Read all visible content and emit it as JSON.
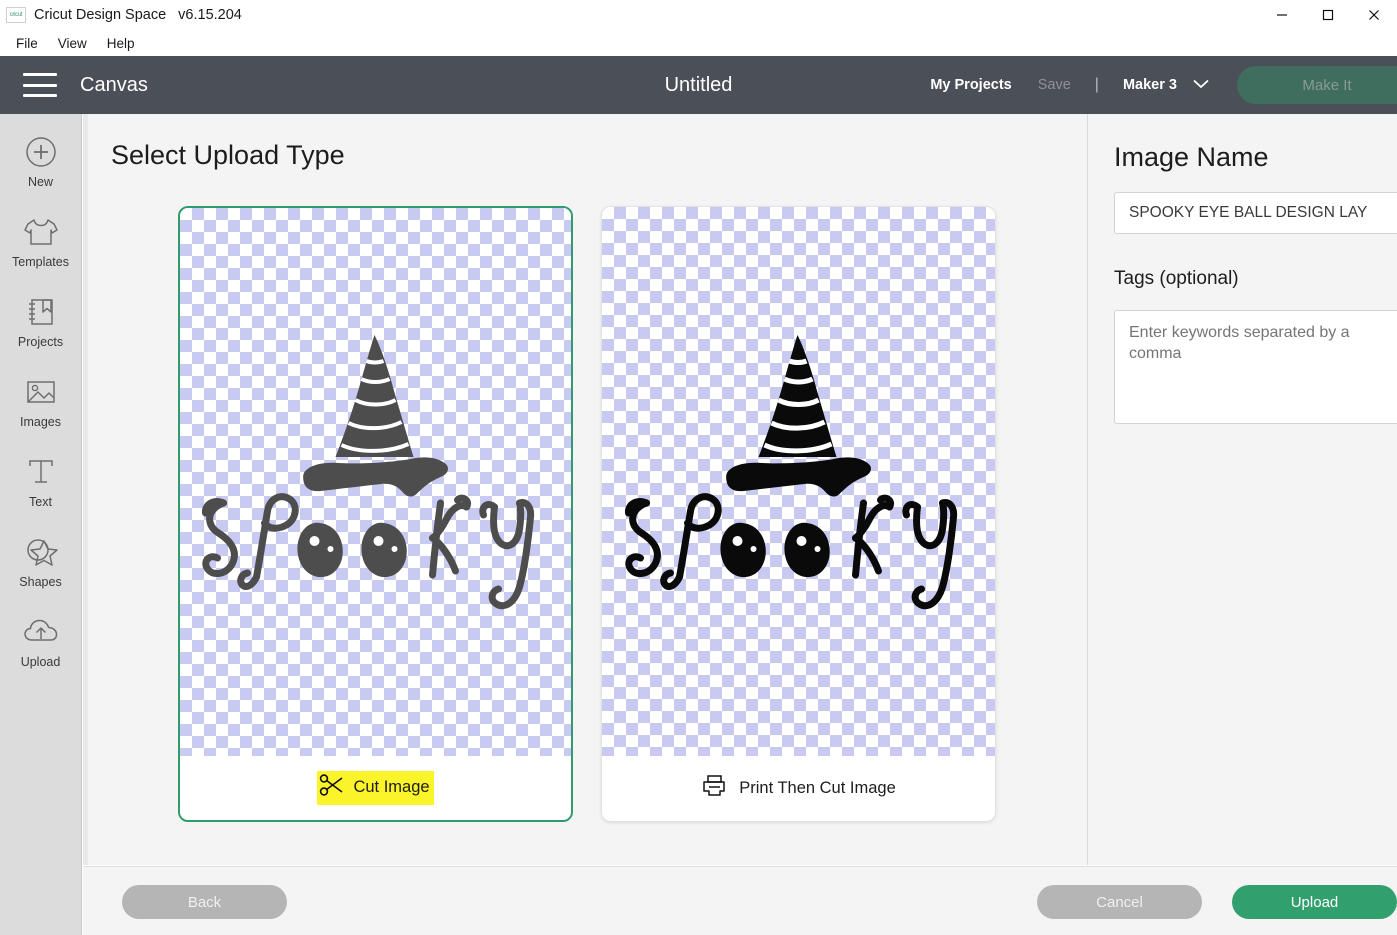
{
  "window": {
    "app_icon_text": "cricut",
    "title": "Cricut Design Space",
    "version": "v6.15.204",
    "controls": [
      {
        "name": "minimize",
        "glyph": "minimize-icon"
      },
      {
        "name": "maximize",
        "glyph": "maximize-icon"
      },
      {
        "name": "close",
        "glyph": "close-icon"
      }
    ]
  },
  "menubar": {
    "items": [
      {
        "label": "File"
      },
      {
        "label": "View"
      },
      {
        "label": "Help"
      }
    ]
  },
  "appheader": {
    "menu_icon": "hamburger-icon",
    "canvas_label": "Canvas",
    "doc_title": "Untitled",
    "my_projects": "My Projects",
    "save": "Save",
    "divider": "|",
    "machine": "Maker 3",
    "machine_chevron": "chevron-down-icon",
    "make_it": "Make It",
    "make_it_color": "#3f6e5f",
    "background_color": "#4b4f57"
  },
  "sidebar": {
    "items": [
      {
        "label": "New",
        "icon": "plus-circle-icon"
      },
      {
        "label": "Templates",
        "icon": "tshirt-icon"
      },
      {
        "label": "Projects",
        "icon": "bookmark-book-icon"
      },
      {
        "label": "Images",
        "icon": "picture-icon"
      },
      {
        "label": "Text",
        "icon": "text-t-icon"
      },
      {
        "label": "Shapes",
        "icon": "shapes-star-icon"
      },
      {
        "label": "Upload",
        "icon": "cloud-upload-icon"
      }
    ]
  },
  "main": {
    "page_title": "Select Upload Type",
    "cards": [
      {
        "id": "cut-image",
        "label": "Cut Image",
        "icon": "scissors-icon",
        "selected": true,
        "highlighted": true,
        "highlight_color": "#fbf42b",
        "border_color": "#2e9c6d",
        "art_color": "#4a4a4a",
        "art_alt": "SPOOKY witch hat lettering preview"
      },
      {
        "id": "print-then-cut-image",
        "label": "Print Then Cut Image",
        "icon": "printer-icon",
        "selected": false,
        "highlighted": false,
        "highlight_color": "",
        "border_color": "#e2e2e2",
        "art_color": "#0a0a0a",
        "art_alt": "SPOOKY witch hat lettering preview"
      }
    ]
  },
  "rightpanel": {
    "image_name_title": "Image Name",
    "image_name_value": "SPOOKY EYE BALL DESIGN LAY",
    "tags_title": "Tags (optional)",
    "tags_value": "",
    "tags_placeholder": "Enter keywords separated by a comma"
  },
  "footer": {
    "back": "Back",
    "cancel": "Cancel",
    "upload": "Upload",
    "upload_color": "#32a06e",
    "disabled_color": "#b5b5b5"
  }
}
